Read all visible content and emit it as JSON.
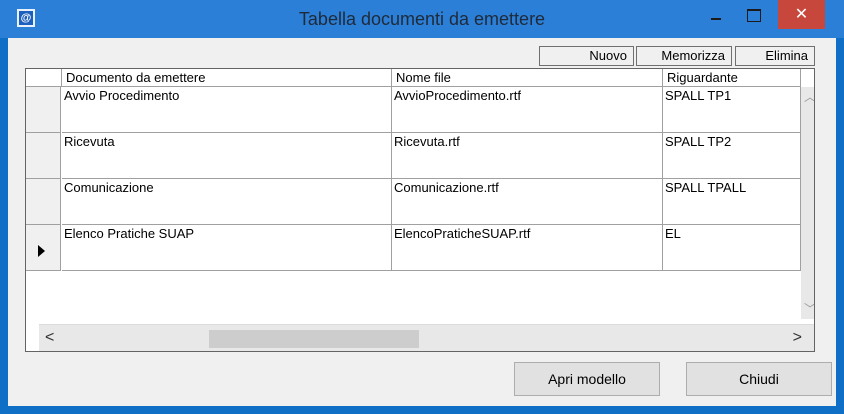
{
  "window": {
    "title": "Tabella documenti da emettere",
    "close_glyph": "✕"
  },
  "toolbar": {
    "new_label": "Nuovo",
    "save_label": "Memorizza",
    "delete_label": "Elimina"
  },
  "table": {
    "columns": [
      "Documento da emettere",
      "Nome file",
      "Riguardante"
    ],
    "rows": [
      {
        "documento": "Avvio Procedimento",
        "nome_file": "AvvioProcedimento.rtf",
        "riguardante": "SPALL TP1"
      },
      {
        "documento": "Ricevuta",
        "nome_file": "Ricevuta.rtf",
        "riguardante": "SPALL TP2"
      },
      {
        "documento": "Comunicazione",
        "nome_file": "Comunicazione.rtf",
        "riguardante": "SPALL TPALL"
      },
      {
        "documento": "Elenco Pratiche SUAP",
        "nome_file": "ElencoPraticheSUAP.rtf",
        "riguardante": "EL"
      }
    ],
    "current_row_index": 3
  },
  "scroll": {
    "left_arrow": "<",
    "right_arrow": ">",
    "up_arrow": "︿",
    "down_arrow": "﹀"
  },
  "footer": {
    "open_template_label": "Apri modello",
    "close_label": "Chiudi"
  }
}
